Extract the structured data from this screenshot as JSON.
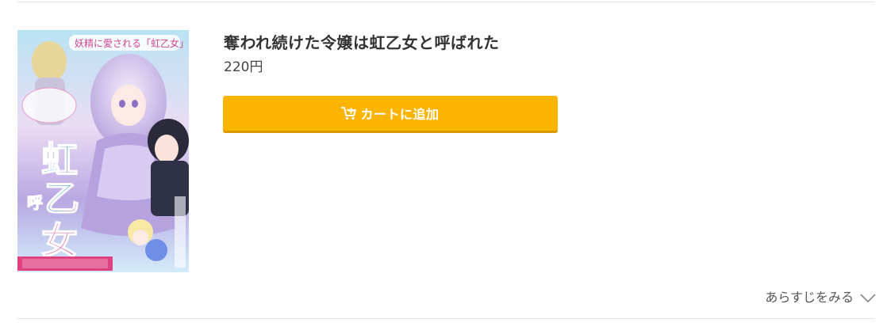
{
  "product": {
    "title": "奪われ続けた令嬢は虹乙女と呼ばれた",
    "price": "220円",
    "cover": {
      "alt_icon": "manga-cover-image",
      "title_text": "奪われ続けた令嬢は虹乙女と呼ばれた"
    }
  },
  "cart_button": {
    "label": "カートに追加",
    "icon": "cart-plus-icon"
  },
  "synopsis": {
    "label": "あらすじをみる",
    "icon": "chevron-down-icon"
  },
  "colors": {
    "button_bg": "#fbb500",
    "button_border": "#d99a00",
    "text": "#333333",
    "divider": "#e3e3e3"
  }
}
